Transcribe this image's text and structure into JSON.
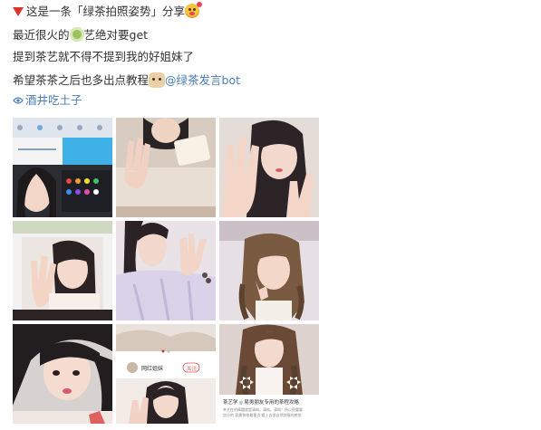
{
  "post": {
    "line1": {
      "prefix": "这是一条「绿茶拍照姿势」分享",
      "emoji": "kiss-heart-emoji"
    },
    "line2": {
      "part1": "最近很火的",
      "emoji": "tea-emoji",
      "part2": "艺绝对要get"
    },
    "line3": {
      "text": "提到茶艺就不得不提到我的好姐妹了"
    },
    "line4": {
      "text": "希望茶茶之后也多出点教程",
      "emoji": "dog-emoji",
      "mention": "@绿茶发言bot"
    },
    "location": {
      "text": "酒井吃土子",
      "icon": "location-icon"
    }
  },
  "images": [
    {
      "name": "photo-edit-tutorial",
      "overlay": ""
    },
    {
      "name": "hands-selfie-1",
      "overlay": ""
    },
    {
      "name": "hands-selfie-2",
      "overlay": ""
    },
    {
      "name": "wave-selfie",
      "overlay": ""
    },
    {
      "name": "pajama-selfie",
      "overlay": ""
    },
    {
      "name": "braids-selfie",
      "overlay": ""
    },
    {
      "name": "closeup-selfie",
      "overlay": ""
    },
    {
      "name": "app-screenshot",
      "overlay": {
        "username": "网红姐妹",
        "button": "关注"
      }
    },
    {
      "name": "bow-braids-selfie",
      "overlay": {
        "caption": "茶艺学🍵易男朋友专用的茶程攻略",
        "body1": "茶艺在的精髓就是清纯，清纯，清纯！所以很重要",
        "body2": "加分的 背景装修最重点 看上去很自然舒服的感觉"
      }
    }
  ],
  "colors": {
    "accent": "#d9342b",
    "link": "#4a7eb8",
    "text": "#333333"
  }
}
